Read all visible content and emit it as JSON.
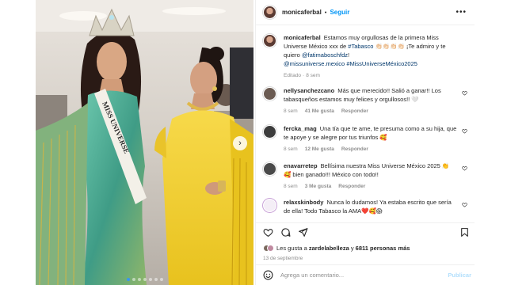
{
  "post": {
    "username": "monicaferbal",
    "follow_label": "Seguir",
    "more_icon": "more-horizontal-icon",
    "photo_sash_text": "MISS UNIVERSE",
    "carousel_pages": 7,
    "carousel_current": 1
  },
  "caption": {
    "username": "monicaferbal",
    "text1": "Estamos muy orgullosas de la primera Miss Universe México xxx de ",
    "hashtag_tabasco": "#Tabasco",
    "text2": " 👏🏻👏🏻👏🏻👏🏻 ¡Te admiro y te quiero ",
    "mention1": "@fatimaboschfdz",
    "text3": "! ",
    "mention2": "@missuniverse.mexico",
    "hashtag2": "#MissUniverseMéxico2025",
    "edited": "Editado",
    "dot": "·",
    "time": "8 sem"
  },
  "comments": [
    {
      "username": "nellysanchezcano",
      "text": "Más que merecido!! Salió a ganar!! Los tabasqueños estamos muy felices y orgullosos!! 🤍",
      "time": "8 sem",
      "likes": "41 Me gusta",
      "reply": "Responder",
      "avatar_color": "#6b5b52"
    },
    {
      "username": "fercka_mag",
      "text": "Una tía que te ame, te presuma como a su hija, que te apoye y se alegre por tus triunfos 🥰",
      "time": "8 sem",
      "likes": "12 Me gusta",
      "reply": "Responder",
      "avatar_color": "#3c3c3c"
    },
    {
      "username": "enavarretep",
      "text": "Bellísima nuestra Miss Universe México 2025 👏 🥰 bien ganado!!! México con todo!!",
      "time": "8 sem",
      "likes": "3 Me gusta",
      "reply": "Responder",
      "avatar_color": "#4a4a4a"
    },
    {
      "username": "relaxskinbody",
      "text": "Nunca lo dudamos! Ya estaba escrito que sería de ella! Todo Tabasco la AMA❤️🥰😱",
      "time": "",
      "likes": "",
      "reply": "",
      "avatar_color": "#f4eef6"
    }
  ],
  "actions": {
    "like_icon": "heart-icon",
    "comment_icon": "comment-icon",
    "share_icon": "share-icon",
    "save_icon": "bookmark-icon",
    "liked_by_prefix": "Les gusta a ",
    "liked_by_user": "zardelabelleza",
    "liked_by_mid": " y ",
    "liked_by_count": "6811 personas más",
    "date": "13 de septiembre"
  },
  "composer": {
    "emoji_icon": "emoji-icon",
    "placeholder": "Agrega un comentario...",
    "submit_label": "Publicar"
  },
  "colors": {
    "accent": "#0095f6",
    "link": "#00376b",
    "muted": "#8e8e8e",
    "dress_yellow": "#f2cf2c",
    "gown_teal": "#3f9c86"
  }
}
